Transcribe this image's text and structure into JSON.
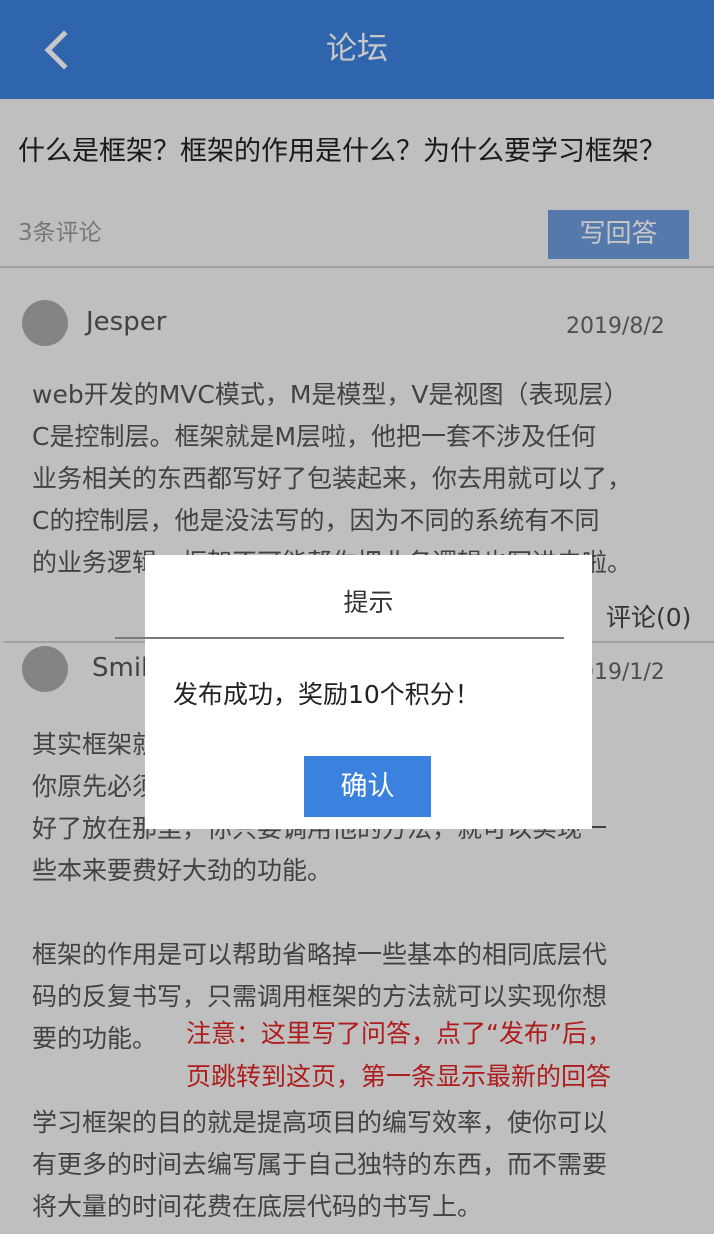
{
  "header": {
    "title": "论坛",
    "back_icon": "chevron-left-icon"
  },
  "question": {
    "text": "什么是框架？框架的作用是什么？为什么要学习框架？",
    "comment_count": "3条评论",
    "answer_button_label": "写回答"
  },
  "answers": [
    {
      "username": "Jesper",
      "date": "2019/8/2",
      "paragraphs": [
        "web开发的MVC模式，M是模型，V是视图（表现层）\nC是控制层。框架就是M层啦，他把一套不涉及任何\n业务相关的东西都写好了包装起来，你去用就可以了，\nC的控制层，他是没法写的，因为不同的系统有不同\n的业务逻辑，框架不可能帮你把业务逻辑也写进去啦。"
      ],
      "reply_label": "评论(0)"
    },
    {
      "username": "Smile",
      "date": "2019/1/2",
      "paragraphs": [
        "其实框架就是给你提供的一套开发的工具，把\n你原先必须要写的一些基本的重复的东西都写\n好了放在那里，你只要调用他的方法，就可以实现一\n些本来要费好大劲的功能。",
        "框架的作用是可以帮助省略掉一些基本的相同底层代\n码的反复书写，只需调用框架的方法就可以实现你想\n要的功能。",
        "学习框架的目的就是提高项目的编写效率，使你可以\n有更多的时间去编写属于自己独特的东西，而不需要\n将大量的时间花费在底层代码的书写上。"
      ]
    }
  ],
  "annotation": "注意：这里写了问答，点了“发布”后，\n页跳转到这页，第一条显示最新的回答",
  "modal": {
    "title": "提示",
    "message": "发布成功，奖励10个积分！",
    "confirm_label": "确认"
  },
  "colors": {
    "accent": "#3b82de",
    "answer_button": "#6f9cdd",
    "annotation": "#e02424"
  }
}
